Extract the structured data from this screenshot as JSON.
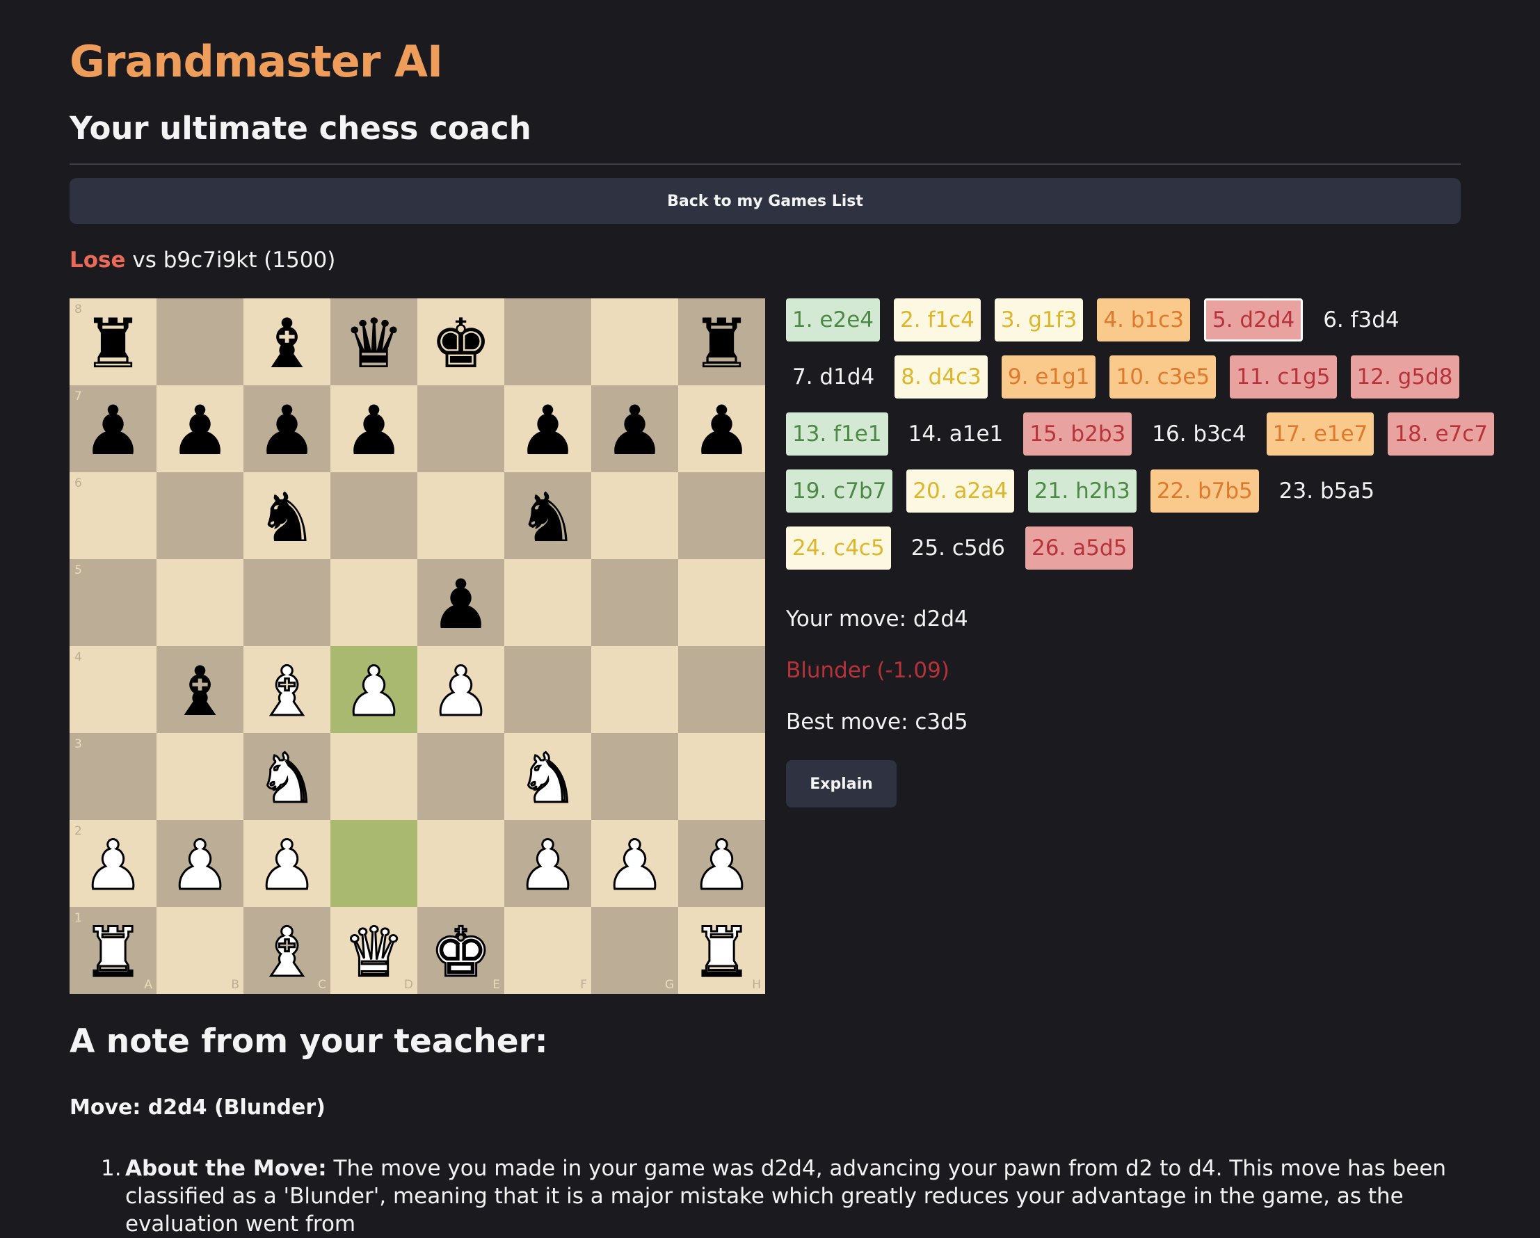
{
  "app": {
    "title": "Grandmaster AI",
    "subtitle": "Your ultimate chess coach"
  },
  "nav": {
    "back_label": "Back to my Games List"
  },
  "game": {
    "result": "Lose",
    "opponent": "vs b9c7i9kt (1500)"
  },
  "board": {
    "files": [
      "A",
      "B",
      "C",
      "D",
      "E",
      "F",
      "G",
      "H"
    ],
    "ranks": [
      "8",
      "7",
      "6",
      "5",
      "4",
      "3",
      "2",
      "1"
    ],
    "rows": [
      [
        "r",
        "",
        "b",
        "q",
        "k",
        "",
        "",
        "r"
      ],
      [
        "p",
        "p",
        "p",
        "p",
        "",
        "p",
        "p",
        "p"
      ],
      [
        "",
        "",
        "n",
        "",
        "",
        "n",
        "",
        ""
      ],
      [
        "",
        "",
        "",
        "",
        "p",
        "",
        "",
        ""
      ],
      [
        "",
        "b",
        "B",
        "P",
        "P",
        "",
        "",
        ""
      ],
      [
        "",
        "",
        "N",
        "",
        "",
        "N",
        "",
        ""
      ],
      [
        "P",
        "P",
        "P",
        "",
        "",
        "P",
        "P",
        "P"
      ],
      [
        "R",
        "",
        "B",
        "Q",
        "K",
        "",
        "",
        "R"
      ]
    ],
    "highlighted": [
      "d4",
      "d2"
    ]
  },
  "moves": {
    "rows": [
      [
        {
          "label": "1. e2e4",
          "cls": "good"
        },
        {
          "label": "2. f1c4",
          "cls": "inacc"
        },
        {
          "label": "3. g1f3",
          "cls": "inacc"
        },
        {
          "label": "4. b1c3",
          "cls": "mistake"
        },
        {
          "label": "5. d2d4",
          "cls": "blunder",
          "selected": true
        },
        {
          "label": "6. f3d4",
          "cls": "neutral"
        }
      ],
      [
        {
          "label": "7. d1d4",
          "cls": "neutral"
        },
        {
          "label": "8. d4c3",
          "cls": "inacc"
        },
        {
          "label": "9. e1g1",
          "cls": "mistake"
        },
        {
          "label": "10. c3e5",
          "cls": "mistake"
        },
        {
          "label": "11. c1g5",
          "cls": "blunder"
        },
        {
          "label": "12. g5d8",
          "cls": "blunder"
        }
      ],
      [
        {
          "label": "13. f1e1",
          "cls": "good"
        },
        {
          "label": "14. a1e1",
          "cls": "neutral"
        },
        {
          "label": "15. b2b3",
          "cls": "blunder"
        },
        {
          "label": "16. b3c4",
          "cls": "neutral"
        },
        {
          "label": "17. e1e7",
          "cls": "mistake"
        },
        {
          "label": "18. e7c7",
          "cls": "blunder"
        }
      ],
      [
        {
          "label": "19. c7b7",
          "cls": "good"
        },
        {
          "label": "20. a2a4",
          "cls": "inacc"
        },
        {
          "label": "21. h2h3",
          "cls": "good"
        },
        {
          "label": "22. b7b5",
          "cls": "mistake"
        },
        {
          "label": "23. b5a5",
          "cls": "neutral"
        }
      ],
      [
        {
          "label": "24. c4c5",
          "cls": "inacc"
        },
        {
          "label": "25. c5d6",
          "cls": "neutral"
        },
        {
          "label": "26. a5d5",
          "cls": "blunder"
        }
      ]
    ]
  },
  "analysis": {
    "your_move": "Your move: d2d4",
    "classification": "Blunder (-1.09)",
    "best_move": "Best move: c3d5",
    "explain_label": "Explain"
  },
  "note": {
    "heading": "A note from your teacher:",
    "move_line": "Move: d2d4 (Blunder)",
    "item_number": "1.",
    "item_title": "About the Move:",
    "item_text": " The move you made in your game was d2d4, advancing your pawn from d2 to d4. This move has been classified as a 'Blunder', meaning that it is a major mistake which greatly reduces your advantage in the game, as the evaluation went from"
  },
  "colors": {
    "accent": "#ee9d5b",
    "lose": "#ea6a58",
    "good": "#d3e9d3",
    "inaccuracy": "#fdf8e1",
    "mistake": "#fac98c",
    "blunder": "#e8a3a1",
    "highlight": "#aab970"
  }
}
